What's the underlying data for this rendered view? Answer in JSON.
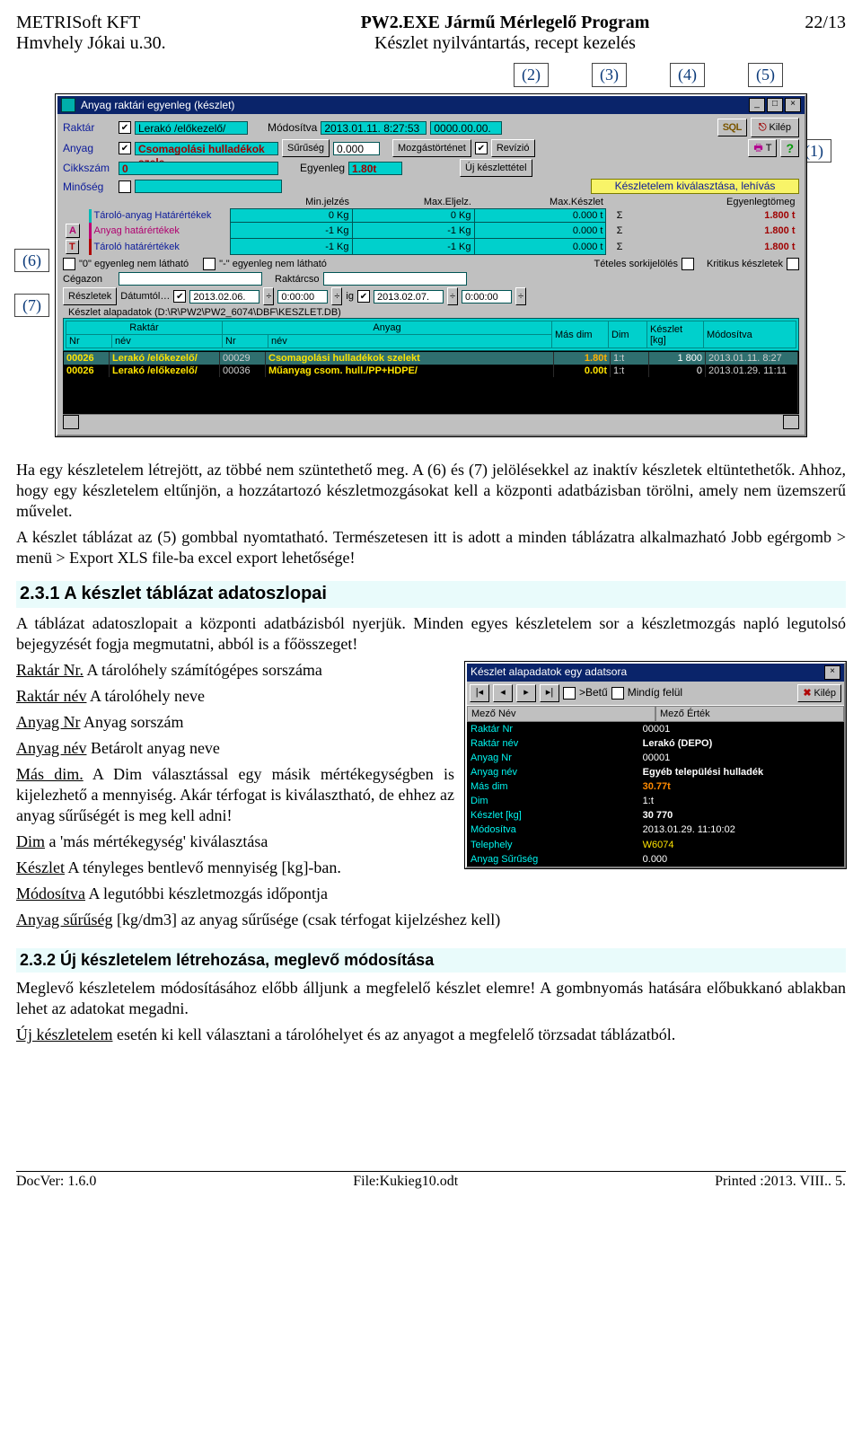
{
  "page": {
    "company": "METRISoft KFT",
    "address": "Hmvhely Jókai u.30.",
    "app_title": "PW2.EXE Jármű Mérlegelő Program",
    "subtitle": "Készlet nyilvántartás, recept kezelés",
    "page_no": "22/13"
  },
  "callouts": {
    "c1": "(1)",
    "c2": "(2)",
    "c3": "(3)",
    "c4": "(4)",
    "c5": "(5)",
    "c6": "(6)",
    "c7": "(7)"
  },
  "win1": {
    "title": "Anyag raktári egyenleg (készlet)",
    "labels": {
      "raktar": "Raktár",
      "anyag": "Anyag",
      "cikkszam": "Cikkszám",
      "minoseg": "Minőség",
      "modositva": "Módosítva",
      "suruseg": "Sűrűség",
      "egyenleg": "Egyenleg",
      "mozgastortenet": "Mozgástörténet",
      "ujkeszlettetel": "Új készlettétel",
      "revizio": "Revízió",
      "kivalaszt": "Készletelem kiválasztása, lehívás",
      "minjelz": "Min.jelzés",
      "maxeljelz": "Max.Eljelz.",
      "maxkeszlet": "Max.Készlet",
      "egyenlegtomeg": "Egyenlegtömeg",
      "targyhatar": "Tároló-anyag Határértékek",
      "anyaghatar": "Anyag határértékek",
      "tarolohatar": "Tároló határértékek",
      "A": "A",
      "T": "T",
      "nullanem": "\"0\" egyenleg nem látható",
      "minusznem": "\"-\" egyenleg nem látható",
      "tetelesork": "Tételes sorkijelölés",
      "kritikus": "Kritikus készletek",
      "cegazon": "Cégazon",
      "raktarcso": "Raktárcso",
      "reszletek": "Részletek",
      "datumtol": "Dátumtól…",
      "ig": "ig",
      "kilep": "Kilép",
      "sql": "SQL",
      "print": "T",
      "help": "?"
    },
    "values": {
      "raktar": "Lerakó /előkezelő/",
      "anyag": "Csomagolási hulladékok szele",
      "cikkszam": "0",
      "modositva1": "2013.01.11. 8:27:53",
      "modositva2": "0000.00.00.",
      "suruseg": "0.000",
      "egyenleg": "1.80t",
      "minoseg": "",
      "date_from": "2013.02.06.",
      "time_from": "0:00:00",
      "date_to": "2013.02.07.",
      "time_to": "0:00:00",
      "groupbox": "Készlet alapadatok (D:\\R\\PW2\\PW2_6074\\DBF\\KESZLET.DB)"
    },
    "limits": [
      [
        "Tároló-anyag Határértékek",
        "0 Kg",
        "0 Kg",
        "0.000 t",
        "Σ",
        "1.800 t"
      ],
      [
        "Anyag határértékek",
        "-1 Kg",
        "-1 Kg",
        "0.000 t",
        "Σ",
        "1.800 t"
      ],
      [
        "Tároló határértékek",
        "-1 Kg",
        "-1 Kg",
        "0.000 t",
        "Σ",
        "1.800 t"
      ]
    ],
    "grid": {
      "cols": {
        "raktar": "Raktár",
        "anyag": "Anyag",
        "masdim": "Más dim",
        "dim": "Dim",
        "keszlet": "Készlet\n[kg]",
        "modositva": "Módosítva",
        "nr": "Nr",
        "nev": "név"
      },
      "rows": [
        {
          "rnr": "00026",
          "rnev": "Lerakó /előkezelő/",
          "anr": "00029",
          "anev": "Csomagolási hulladékok szelekt",
          "masdim": "1.80t",
          "dim": "1:t",
          "keszlet": "1 800",
          "mod": "2013.01.11. 8:27"
        },
        {
          "rnr": "00026",
          "rnev": "Lerakó /előkezelő/",
          "anr": "00036",
          "anev": "Műanyag csom. hull./PP+HDPE/",
          "masdim": "0.00t",
          "dim": "1:t",
          "keszlet": "0",
          "mod": "2013.01.29. 11:11"
        }
      ]
    }
  },
  "article": {
    "p1": "Ha egy készletelem létrejött, az többé nem szüntethető meg. A (6) és (7) jelölésekkel az inaktív készletek eltüntethetők. Ahhoz, hogy egy készletelem eltűnjön, a hozzátartozó készletmozgásokat kell a központi adatbázisban törölni, amely nem üzemszerű művelet.",
    "p2": "A készlet táblázat az (5) gombbal nyomtatható. Természetesen itt is adott a minden táblázatra alkalmazható Jobb egérgomb > menü > Export XLS file-ba excel export lehetősége!",
    "h231": "2.3.1 A készlet táblázat adatoszlopai",
    "p3": "A táblázat adatoszlopait a központi adatbázisból nyerjük. Minden egyes készletelem sor a készletmozgás napló legutolsó bejegyzését fogja megmutatni, abból is a főösszeget!",
    "fields": [
      [
        "Raktár Nr.",
        "A tárolóhely számítógépes sorszáma"
      ],
      [
        "Raktár név",
        "A tárolóhely neve"
      ],
      [
        "Anyag Nr",
        "Anyag sorszám"
      ],
      [
        "Anyag név",
        "Betárolt anyag neve"
      ],
      [
        "Más dim.",
        "A Dim választással egy másik mértékegységben is kijelezhető a mennyiség. Akár térfogat is kiválasztható, de ehhez az anyag sűrűségét is meg kell adni!"
      ],
      [
        "Dim",
        "a 'más mértékegység' kiválasztása"
      ],
      [
        "Készlet",
        "A tényleges bentlevő mennyiség [kg]-ban."
      ],
      [
        "Módosítva",
        "A legutóbbi készletmozgás időpontja"
      ],
      [
        "Anyag sűrűség",
        "[kg/dm3] az anyag sűrűsége (csak térfogat kijelzéshez kell)"
      ]
    ],
    "h232": "2.3.2 Új készletelem létrehozása, meglevő módosítása",
    "p4": "Meglevő készletelem módosításához előbb álljunk a megfelelő készlet elemre! A gombnyomás hatására előbukkanó ablakban lehet az adatokat megadni.",
    "p5_a": "Új készletelem",
    "p5_b": " esetén ki kell választani a tárolóhelyet és az anyagot a megfelelő törzsadat táblázatból."
  },
  "win2": {
    "title": "Készlet alapadatok  egy adatsora",
    "betu": ">Betű",
    "mindig": "Mindíg felül",
    "kilep": "Kilép",
    "cols": {
      "k": "Mező Név",
      "v": "Mező Érték"
    },
    "rows": [
      [
        "Raktár Nr",
        "00001"
      ],
      [
        "Raktár név",
        "Lerakó (DEPO)"
      ],
      [
        "Anyag Nr",
        "00001"
      ],
      [
        "Anyag név",
        "Egyéb települési hulladék"
      ],
      [
        "Más dim",
        "30.77t"
      ],
      [
        "Dim",
        "1:t"
      ],
      [
        "Készlet [kg]",
        "30 770"
      ],
      [
        "Módosítva",
        "2013.01.29. 11:10:02"
      ],
      [
        "Telephely",
        "W6074"
      ],
      [
        "Anyag Sűrűség",
        "0.000"
      ]
    ]
  },
  "footer": {
    "left": "DocVer: 1.6.0",
    "center": "File:Kukieg10.odt",
    "right": "Printed :2013. VIII.. 5."
  }
}
